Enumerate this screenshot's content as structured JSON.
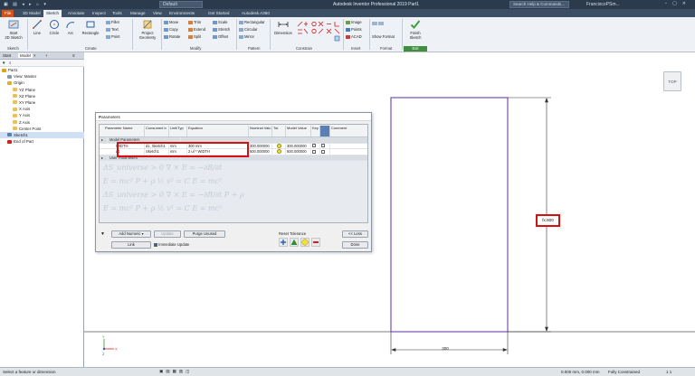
{
  "titlebar": {
    "document": "Default",
    "app_title": "Autodesk Inventor Professional 2019   Part1",
    "search_placeholder": "Search Help & Commands...",
    "user": "FranciscoPSm..."
  },
  "tabs": [
    "File",
    "3D Model",
    "Sketch",
    "Annotate",
    "Inspect",
    "Tools",
    "Manage",
    "View",
    "Environments",
    "Get Started",
    "Autodesk A360"
  ],
  "ribbon": {
    "start_sketch": "Start\n2D Sketch",
    "sketch_group": "Sketch",
    "line": "Line",
    "circle": "Circle",
    "arc": "Arc",
    "rectangle": "Rectangle",
    "fillet": "Fillet",
    "text": "Text",
    "point": "Point",
    "create_group": "Create",
    "project_geometry": "Project\nGeometry",
    "move": "Move",
    "copy": "Copy",
    "rotate": "Rotate",
    "trim": "Trim",
    "extend": "Extend",
    "split": "Split",
    "scale": "Scale",
    "stretch": "Stretch",
    "offset": "Offset",
    "modify_group": "Modify",
    "rectangular": "Rectangular",
    "circular": "Circular",
    "mirror": "Mirror",
    "pattern_group": "Pattern",
    "dimension": "Dimension",
    "constrain_group": "Constrain",
    "image": "Image",
    "points": "Points",
    "acad": "ACAD",
    "insert_group": "Insert",
    "show_format": "Show Format",
    "format_group": "Format",
    "finish_sketch": "Finish\nSketch",
    "exit_group": "Exit"
  },
  "browser": {
    "tab1": "Start",
    "tab2": "Model",
    "tree": [
      {
        "label": "Part1",
        "indent": 0,
        "color": "#e0a020",
        "selected": false
      },
      {
        "label": "View: Master",
        "indent": 1,
        "color": "#8899aa",
        "selected": false
      },
      {
        "label": "Origin",
        "indent": 1,
        "color": "#d8b040",
        "selected": false
      },
      {
        "label": "YZ Plane",
        "indent": 2,
        "color": "#e8c060",
        "selected": false
      },
      {
        "label": "XZ Plane",
        "indent": 2,
        "color": "#e8c060",
        "selected": false
      },
      {
        "label": "XY Plane",
        "indent": 2,
        "color": "#e8c060",
        "selected": false
      },
      {
        "label": "X Axis",
        "indent": 2,
        "color": "#e8c060",
        "selected": false
      },
      {
        "label": "Y Axis",
        "indent": 2,
        "color": "#e8c060",
        "selected": false
      },
      {
        "label": "Z Axis",
        "indent": 2,
        "color": "#e8c060",
        "selected": false
      },
      {
        "label": "Center Point",
        "indent": 2,
        "color": "#e8c060",
        "selected": false
      },
      {
        "label": "Sketch1",
        "indent": 1,
        "color": "#5a7fb5",
        "selected": true
      },
      {
        "label": "End of Part",
        "indent": 1,
        "color": "#d02020",
        "selected": false
      }
    ]
  },
  "viewcube": "TOP",
  "dialog": {
    "title": "Parameters",
    "columns": [
      "Parameter Name",
      "Consumed b",
      "Unit/Typ",
      "Equation",
      "Nominal Valu",
      "Tol.",
      "Model Value",
      "Key",
      "Comment"
    ],
    "section_model": "Model Parameters",
    "section_user": "User Parameters",
    "rows": [
      {
        "name": "WIDTH",
        "consumed": "d1, Sketch1",
        "unit": "mm",
        "equation": "300 mm",
        "nominal": "300.000000",
        "model": "300.000000"
      },
      {
        "name": "d1",
        "consumed": "Sketch1",
        "unit": "mm",
        "equation": "2 ul * WIDTH",
        "nominal": "600.000000",
        "model": "600.000000"
      }
    ],
    "add_numeric": "Add Numeric",
    "update": "Update",
    "purge_unused": "Purge Unused",
    "link": "Link",
    "immediate_update": "Immediate Update",
    "reset_tolerance": "Reset Tolerance",
    "less": "<< Less",
    "done": "Done",
    "watermark": [
      "ΔS_universe > 0   ∇ × E = −∂B/∂t   ",
      "E = mc²   P + ρ ½ v² = C   E = mc²",
      "ΔS_universe > 0   ∇ × E = −∂B/∂t   P + ρ"
    ]
  },
  "sketch": {
    "dim_horizontal": "300",
    "dim_vertical": "fx:600",
    "rect_color": "#6a3fb0"
  },
  "status": {
    "left": "Select a feature or dimension",
    "coords": "0.000 mm, 0.000 mm",
    "constrained": "Fully Constrained",
    "counts": "1   1"
  },
  "colors": {
    "file_tab": "#d0531a",
    "highlight": "#d51010",
    "finish_green": "#3f8f3f"
  }
}
